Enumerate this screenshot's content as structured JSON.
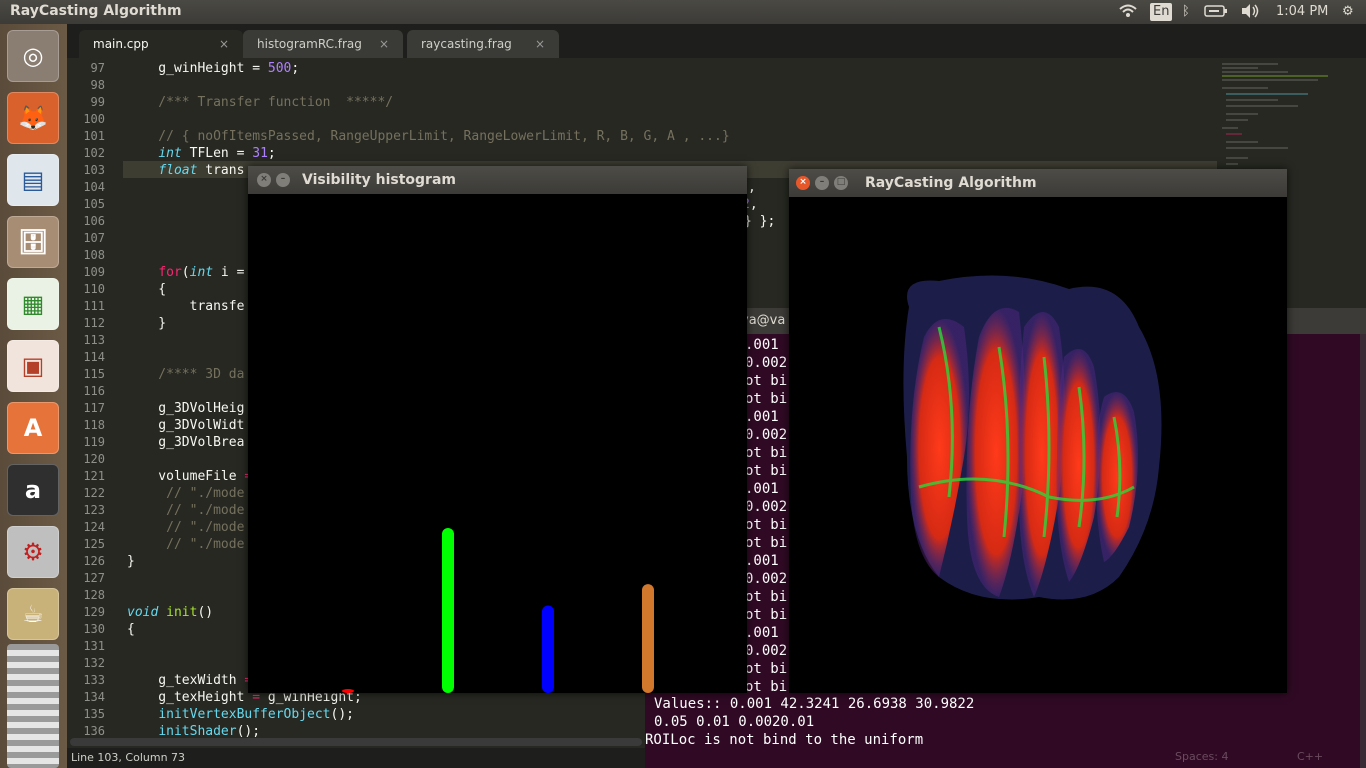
{
  "top_panel": {
    "title": "RayCasting Algorithm",
    "keyboard_layout": "En",
    "clock": "1:04 PM"
  },
  "launcher": {
    "items": [
      "ubuntu-dash",
      "firefox",
      "libreoffice-impress",
      "files",
      "libreoffice-calc",
      "libreoffice-writer",
      "software-center",
      "amazon",
      "system-settings",
      "opengl-app"
    ]
  },
  "editor": {
    "tabs": [
      {
        "label": "main.cpp",
        "active": true
      },
      {
        "label": "histogramRC.frag",
        "active": false
      },
      {
        "label": "raycasting.frag",
        "active": false
      }
    ],
    "tab_close": "×",
    "line_numbers": [
      "97",
      "98",
      "99",
      "100",
      "101",
      "102",
      "103",
      "104",
      "105",
      "106",
      "107",
      "108",
      "109",
      "110",
      "111",
      "112",
      "113",
      "114",
      "115",
      "116",
      "117",
      "118",
      "119",
      "120",
      "121",
      "122",
      "123",
      "124",
      "125",
      "126",
      "127",
      "128",
      "129",
      "130",
      "131",
      "132",
      "133",
      "134",
      "135",
      "136"
    ],
    "status": "Line 103, Column 73",
    "status_right": {
      "spaces": "Spaces: 4",
      "syntax": "C++"
    }
  },
  "terminal": {
    "title_fragment": "ya@va",
    "lines": [
      ".001",
      "0.002",
      "ot bi",
      "ot bi",
      ".001",
      "0.002",
      "ot bi",
      "ot bi",
      ".001",
      "0.002",
      "ot bi",
      "ot bi",
      ".001",
      "0.002",
      "ot bi",
      "ot bi",
      ".001",
      "0.002",
      "ot bi",
      "ot bi"
    ],
    "bottom_lines": [
      "Values:: 0.001 42.3241 26.6938 30.9822",
      "0.05 0.01 0.0020.01",
      "ROILoc is not bind to the uniform"
    ]
  },
  "histogram_window": {
    "title": "Visibility histogram",
    "bars": [
      {
        "color": "#ff0000",
        "value": 0.02
      },
      {
        "color": "#00ff00",
        "value": 1.0
      },
      {
        "color": "#0000ff",
        "value": 0.53
      },
      {
        "color": "#d2782d",
        "value": 0.66
      }
    ]
  },
  "raycasting_window": {
    "title": "RayCasting Algorithm"
  }
}
